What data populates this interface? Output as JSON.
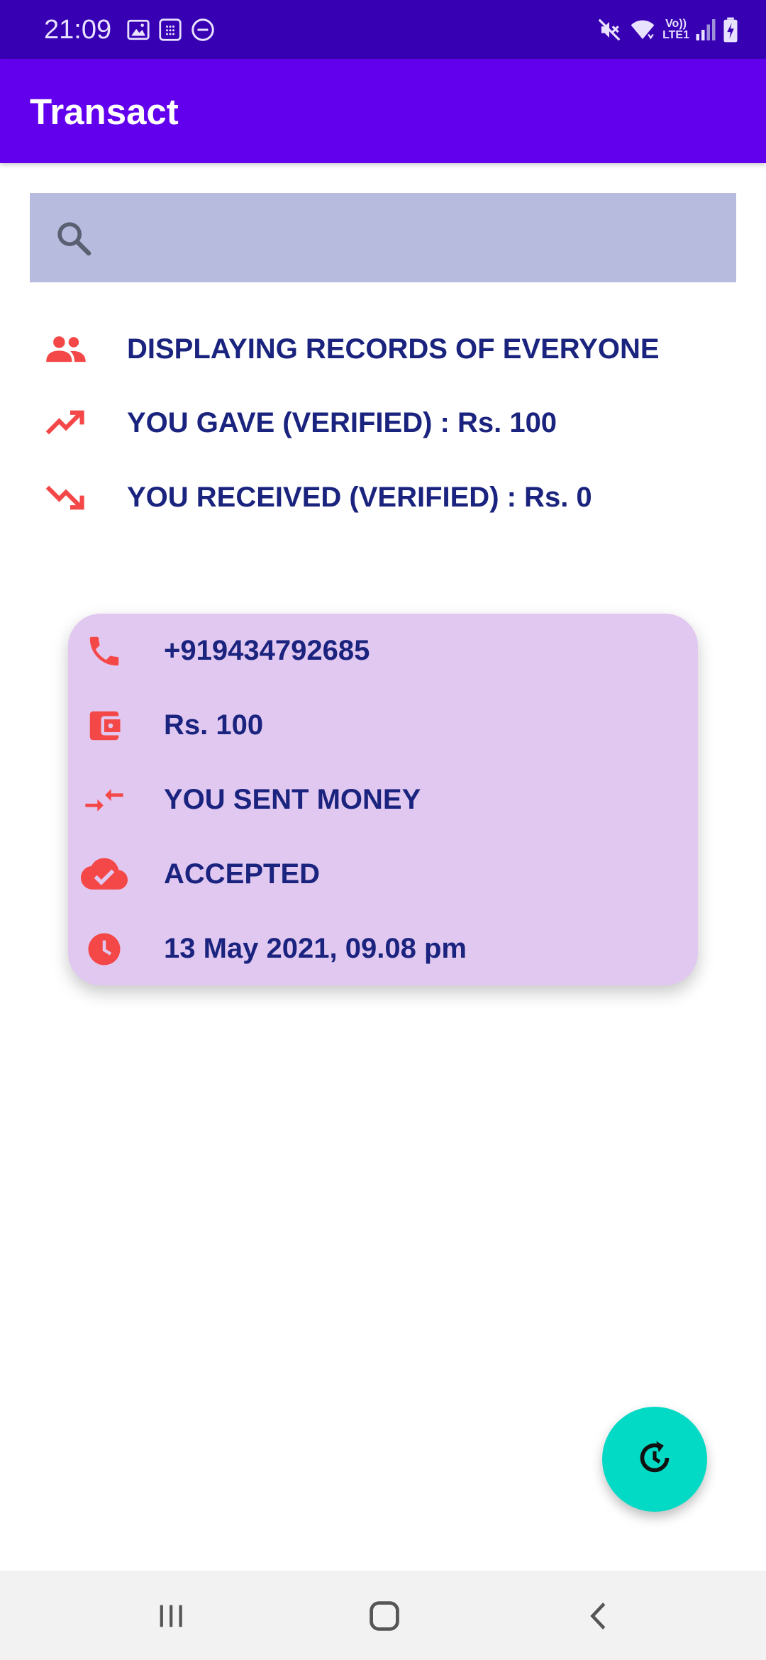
{
  "status_bar": {
    "time": "21:09",
    "left_icons": [
      "image-icon",
      "calculator-icon",
      "do-not-disturb-icon"
    ],
    "right_icons": [
      "mute-icon",
      "wifi-icon",
      "volte-lte-icon",
      "signal-icon",
      "battery-charging-icon"
    ],
    "volte_label": "Vo))",
    "lte_label": "LTE1"
  },
  "app_bar": {
    "title": "Transact"
  },
  "search": {
    "value": "",
    "placeholder": "",
    "icon": "search-icon"
  },
  "summary": {
    "rows": [
      {
        "icon": "people-icon",
        "text": "DISPLAYING RECORDS OF EVERYONE"
      },
      {
        "icon": "trending-up-icon",
        "text": "YOU GAVE (VERIFIED) : Rs. 100"
      },
      {
        "icon": "trending-down-icon",
        "text": "YOU RECEIVED (VERIFIED) : Rs. 0"
      }
    ]
  },
  "transactions": [
    {
      "phone": "+919434792685",
      "amount": "Rs. 100",
      "direction": "YOU SENT MONEY",
      "status": "ACCEPTED",
      "datetime": "13 May 2021, 09.08 pm"
    }
  ],
  "fab": {
    "icon": "refresh-history-icon"
  },
  "nav_bar": {
    "items": [
      "recent-apps-icon",
      "home-icon",
      "back-icon"
    ]
  },
  "colors": {
    "status_bar": "#3700b3",
    "app_bar": "#6200ee",
    "search_bg": "#b7bcdf",
    "text_primary": "#1a237e",
    "icon_accent": "#f44747",
    "card_bg": "#e1c8f0",
    "fab": "#03dac5",
    "nav_bar": "#f2f2f2"
  }
}
